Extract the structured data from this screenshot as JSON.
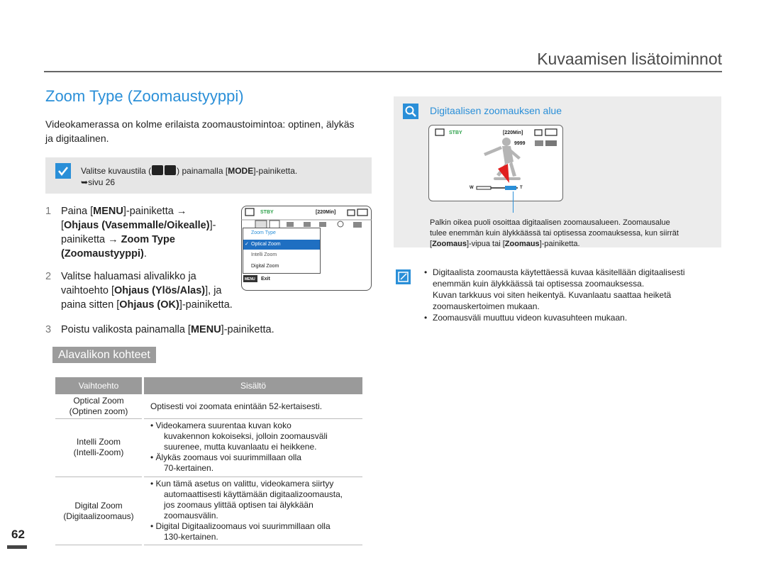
{
  "header": {
    "chapter_title": "Kuvaamisen lisätoiminnot"
  },
  "section": {
    "title": "Zoom Type (Zoomaustyyppi)",
    "intro": "Videokamerassa on kolme erilaista zoomaustoimintoa: optinen, älykäs ja digitaalinen.",
    "note_prefix": "Valitse kuvaustila (",
    "note_suffix_pre": ") painamalla [",
    "note_mode": "MODE",
    "note_suffix_post": "]-painiketta.",
    "note_page_ref": "sivu 26"
  },
  "steps": [
    {
      "num": "1",
      "line1_pre": "Paina [",
      "line1_bold": "MENU",
      "line1_post": "]-painiketta →",
      "line2_pre": "[",
      "line2_bold": "Ohjaus (Vasemmalle/Oikealle)",
      "line2_post": "]-",
      "line3_pre": "painiketta → ",
      "line3_bold": "Zoom Type",
      "line4_bold": "(Zoomaustyyppi)",
      "line4_post": "."
    },
    {
      "num": "2",
      "line1": "Valitse haluamasi alivalikko ja",
      "line2_pre": "vaihtoehto [",
      "line2_bold": "Ohjaus (Ylös/Alas)",
      "line2_post": "], ja",
      "line3_pre": "paina sitten [",
      "line3_bold": "Ohjaus (OK)",
      "line3_post": "]-painiketta."
    },
    {
      "num": "3",
      "line1_pre": "Poistu valikosta painamalla [",
      "line1_bold": "MENU",
      "line1_post": "]-painiketta."
    }
  ],
  "camera_screen": {
    "stby": "STBY",
    "remaining": "[220Min]",
    "menu_title": "Zoom Type",
    "items": [
      "Optical Zoom",
      "Intelli Zoom",
      "Digital Zoom"
    ],
    "selected_index": 0,
    "menu_button": "MENU",
    "exit": "Exit"
  },
  "subsection_title": "Alavalikon kohteet",
  "table": {
    "headers": [
      "Vaihtoehto",
      "Sisältö"
    ],
    "rows": [
      {
        "option": [
          "Optical Zoom",
          "(Optinen zoom)"
        ],
        "content": [
          "Optisesti voi zoomata enintään 52-kertaisesti."
        ]
      },
      {
        "option": [
          "Intelli Zoom",
          "(Intelli-Zoom)"
        ],
        "content": [
          "• Videokamera suurentaa kuvan koko",
          "kuvakennon kokoiseksi, jolloin zoomausväli",
          "suurenee, mutta kuvanlaatu ei heikkene.",
          "• Älykäs zoomaus voi suurimmillaan olla",
          "70-kertainen."
        ]
      },
      {
        "option": [
          "Digital Zoom",
          "(Digitaalizoomaus)"
        ],
        "content": [
          "• Kun tämä asetus on valittu, videokamera siirtyy",
          "automaattisesti käyttämään digitaalizoomausta,",
          "jos zoomaus ylittää optisen tai älykkään",
          "zoomausvälin.",
          "• Digital Digitaalizoomaus voi suurimmillaan olla",
          "130-kertainen."
        ]
      }
    ]
  },
  "right_panel": {
    "title": "Digitaalisen zoomauksen alue",
    "lcd_stby": "STBY",
    "lcd_remaining": "[220Min]",
    "lcd_count": "9999",
    "lcd_w": "W",
    "lcd_t": "T",
    "caption_pre": "Palkin oikea puoli osoittaa digitaalisen zoomausalueen. Zoomausalue tulee enemmän kuin älykkäässä tai optisessa zoomauksessa. ",
    "caption": "Palkin oikea puoli osoittaa digitaalisen zoomausalueen. Zoomausalue",
    "caption2_pre": "tulee enemmän kuin älykkäässä tai optisessa zoomauksessa, kun siirrät [",
    "caption2_bold1": "Zoomaus",
    "caption2_mid": "]-vipua tai [",
    "caption2_bold2": "Zoomaus",
    "caption2_post": "]-painiketta."
  },
  "notes": [
    "Digitaalista zoomausta käytettäessä kuvaa käsitellään digitaalisesti enemmän kuin älykkäässä tai optisessa zoomauksessa.",
    "Kuvan tarkkuus voi siten heikentyä. Kuvanlaatu saattaa heiketä zoomauskertoimen mukaan.",
    "Zoomausväli muuttuu videon kuvasuhteen mukaan."
  ],
  "page_number": "62",
  "colors": {
    "accent": "#2a8fd8",
    "header_gray": "#9a9a9a",
    "panel_gray": "#ececec"
  }
}
